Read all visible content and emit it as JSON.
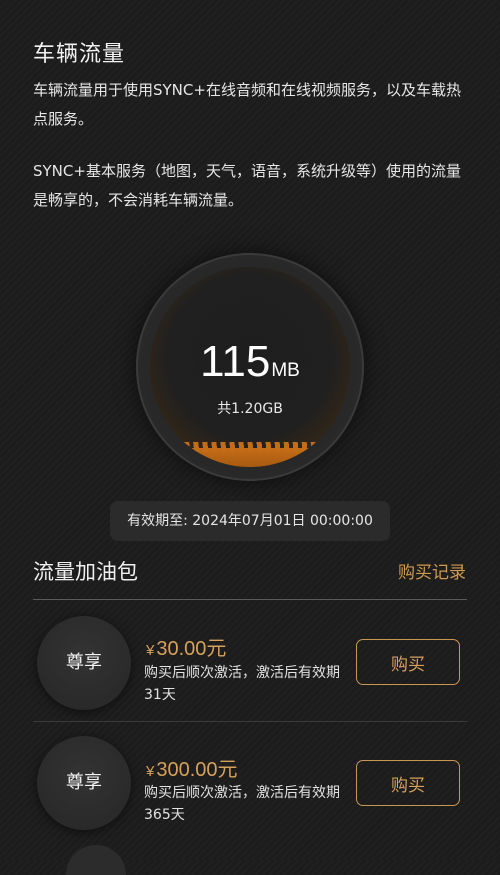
{
  "page": {
    "title": "车辆流量",
    "desc1": "车辆流量用于使用SYNC+在线音频和在线视频服务，以及车载热点服务。",
    "desc2": "SYNC+基本服务（地图，天气，语音，系统升级等）使用的流量是畅享的，不会消耗车辆流量。"
  },
  "gauge": {
    "used_value": "115",
    "used_unit": "MB",
    "total_label": "共1.20GB",
    "used_fraction": 0.094
  },
  "validity": "有效期至: 2024年07月01日 00:00:00",
  "packages_section": {
    "title": "流量加油包",
    "history_link": "购买记录",
    "items": [
      {
        "badge": "尊享",
        "currency": "¥",
        "price": "30.00元",
        "description": "购买后顺次激活，激活后有效期31天",
        "button": "购买"
      },
      {
        "badge": "尊享",
        "currency": "¥",
        "price": "300.00元",
        "description": "购买后顺次激活，激活后有效期365天",
        "button": "购买"
      }
    ]
  },
  "colors": {
    "accent": "#d6a15a",
    "gauge_fill": "#c46d18",
    "background": "#1c1c1c"
  }
}
